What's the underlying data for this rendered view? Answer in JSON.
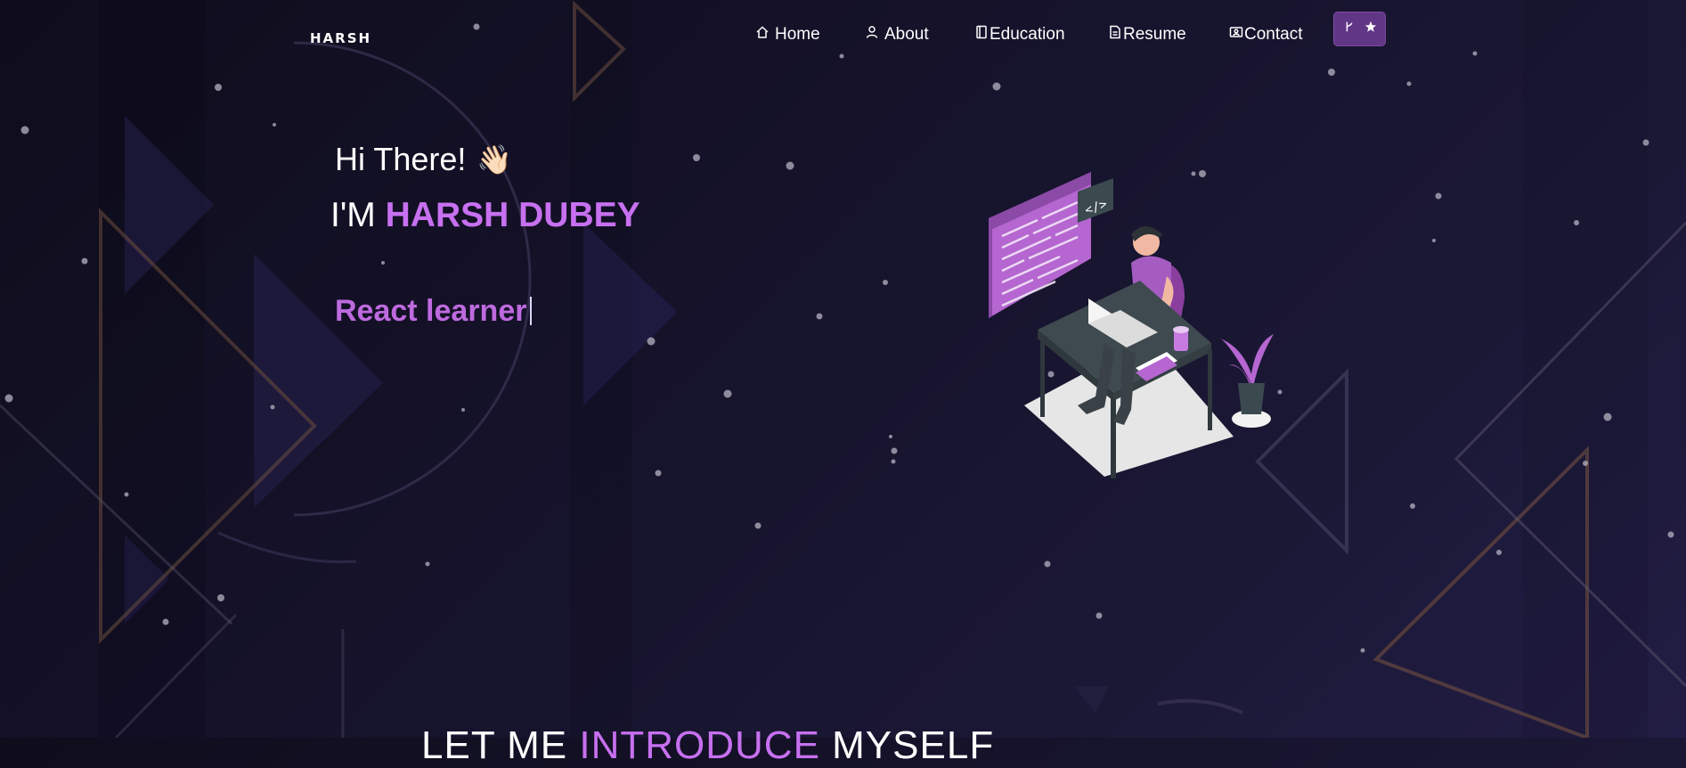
{
  "navbar": {
    "brand": "HARSH",
    "items": [
      {
        "label": "Home",
        "icon": "home-icon"
      },
      {
        "label": "About",
        "icon": "user-icon"
      },
      {
        "label": "Education",
        "icon": "book-icon"
      },
      {
        "label": "Resume",
        "icon": "document-icon"
      },
      {
        "label": "Contact",
        "icon": "contact-card-icon"
      }
    ],
    "fork_button": {
      "icons": [
        "git-fork-icon",
        "star-icon"
      ]
    }
  },
  "hero": {
    "greeting": "Hi There!",
    "wave_emoji": "👋🏻",
    "name_prefix": "I'M",
    "name": "HARSH DUBEY",
    "typewriter_text": "React learner"
  },
  "intro": {
    "part1": "LET ME",
    "highlight": "INTRODUCE",
    "part2": "MYSELF"
  },
  "colors": {
    "accent": "#c770f0",
    "typewriter": "#be6adf",
    "button_bg": "#623686",
    "background": "#15122a"
  }
}
